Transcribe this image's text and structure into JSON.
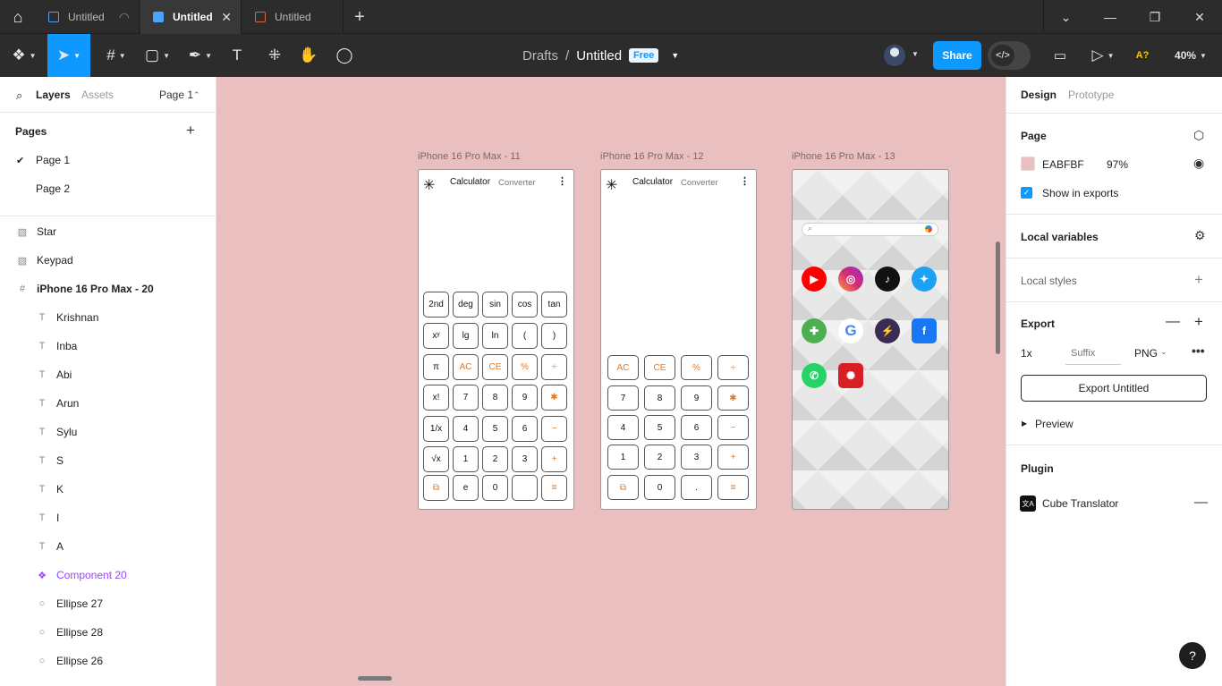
{
  "tabs": [
    {
      "label": "Untitled"
    },
    {
      "label": "Untitled"
    },
    {
      "label": "Untitled"
    }
  ],
  "toolbar": {
    "breadcrumb_parent": "Drafts",
    "breadcrumb_sep": "/",
    "file_name": "Untitled",
    "plan_badge": "Free",
    "share_label": "Share",
    "zoom": "40%",
    "ai_label": "A?"
  },
  "left_panel": {
    "tab_layers": "Layers",
    "tab_assets": "Assets",
    "page_selector": "Page 1",
    "pages_title": "Pages",
    "pages": [
      "Page 1",
      "Page 2"
    ],
    "layers": [
      {
        "name": "Star",
        "icon": "image-icon"
      },
      {
        "name": "Keypad",
        "icon": "image-icon"
      },
      {
        "name": "iPhone 16 Pro Max - 20",
        "icon": "frame-icon"
      },
      {
        "name": "Krishnan",
        "icon": "text-icon"
      },
      {
        "name": "Inba",
        "icon": "text-icon"
      },
      {
        "name": "Abi",
        "icon": "text-icon"
      },
      {
        "name": "Arun",
        "icon": "text-icon"
      },
      {
        "name": "Sylu",
        "icon": "text-icon"
      },
      {
        "name": "S",
        "icon": "text-icon"
      },
      {
        "name": "K",
        "icon": "text-icon"
      },
      {
        "name": "I",
        "icon": "text-icon"
      },
      {
        "name": "A",
        "icon": "text-icon"
      },
      {
        "name": "Component 20",
        "icon": "component-icon"
      },
      {
        "name": "Ellipse 27",
        "icon": "ellipse-icon"
      },
      {
        "name": "Ellipse 28",
        "icon": "ellipse-icon"
      },
      {
        "name": "Ellipse 26",
        "icon": "ellipse-icon"
      }
    ]
  },
  "canvas": {
    "background": "#EABFBF",
    "frames": [
      {
        "label": "iPhone 16 Pro Max - 11",
        "title": "Calculator",
        "subtitle": "Converter",
        "keys": [
          [
            "2nd",
            "deg",
            "sin",
            "cos",
            "tan"
          ],
          [
            "xʸ",
            "lg",
            "ln",
            "(",
            ")"
          ],
          [
            "π",
            "AC",
            "CE",
            "%",
            "÷"
          ],
          [
            "x!",
            "7",
            "8",
            "9",
            "✱"
          ],
          [
            "1/x",
            "4",
            "5",
            "6",
            "−"
          ],
          [
            "√x",
            "1",
            "2",
            "3",
            "+"
          ],
          [
            "",
            "e",
            "0",
            "",
            "="
          ]
        ]
      },
      {
        "label": "iPhone 16 Pro Max - 12",
        "title": "Calculator",
        "subtitle": "Converter",
        "keys": [
          [
            "AC",
            "CE",
            "%",
            "÷"
          ],
          [
            "7",
            "8",
            "9",
            "✱"
          ],
          [
            "4",
            "5",
            "6",
            "−"
          ],
          [
            "1",
            "2",
            "3",
            "+"
          ],
          [
            "",
            "0",
            ".",
            "="
          ]
        ]
      },
      {
        "label": "iPhone 16 Pro Max - 13",
        "apps": [
          [
            "youtube-icon",
            "instagram-icon",
            "tiktok-icon",
            "twitter-icon"
          ],
          [
            "game-icon",
            "google-icon",
            "game2-icon",
            "facebook-icon"
          ],
          [
            "whatsapp-icon",
            "redapp-icon"
          ]
        ]
      }
    ]
  },
  "right_panel": {
    "tab_design": "Design",
    "tab_prototype": "Prototype",
    "page_title": "Page",
    "page_color": "EABFBF",
    "page_opacity": "97%",
    "show_in_exports": "Show in exports",
    "local_variables": "Local variables",
    "local_styles": "Local styles",
    "export_title": "Export",
    "export_scale": "1x",
    "export_suffix_placeholder": "Suffix",
    "export_format": "PNG",
    "export_button": "Export Untitled",
    "preview": "Preview",
    "plugin_title": "Plugin",
    "plugin_name": "Cube Translator"
  }
}
